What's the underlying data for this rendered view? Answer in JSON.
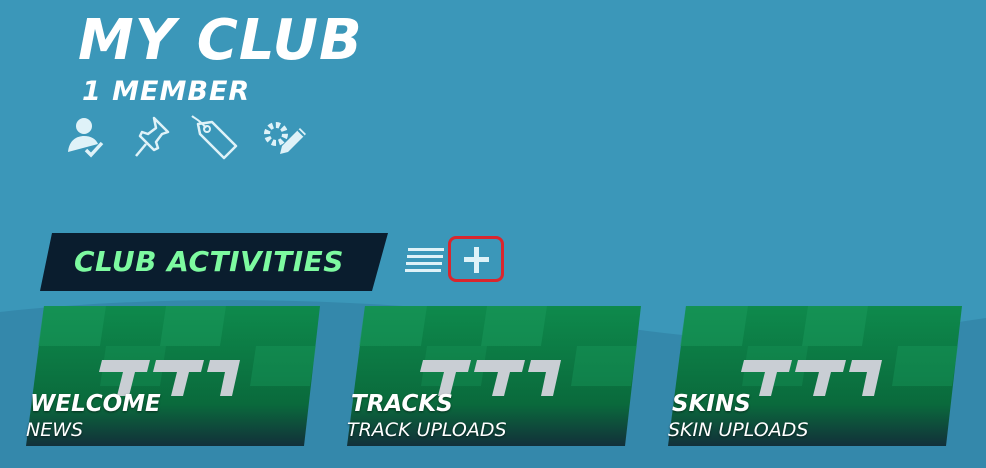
{
  "club": {
    "title": "MY CLUB",
    "member_count": "1 MEMBER"
  },
  "club_icons": [
    "member-check-icon",
    "pin-icon",
    "tag-icon",
    "settings-edit-icon"
  ],
  "section": {
    "label": "CLUB ACTIVITIES"
  },
  "activities": [
    {
      "title": "WELCOME",
      "subtitle": "NEWS",
      "logo": "tm-logo"
    },
    {
      "title": "TRACKS",
      "subtitle": "TRACK UPLOADS",
      "logo": "tm-logo"
    },
    {
      "title": "SKINS",
      "subtitle": "SKIN UPLOADS",
      "logo": "tm-logo"
    }
  ],
  "colors": {
    "background": "#3b97b9",
    "section_tab": "#0a1d2e",
    "section_text": "#7dfaa0",
    "card_green": "#0b7a44",
    "highlight": "#d9262e"
  }
}
